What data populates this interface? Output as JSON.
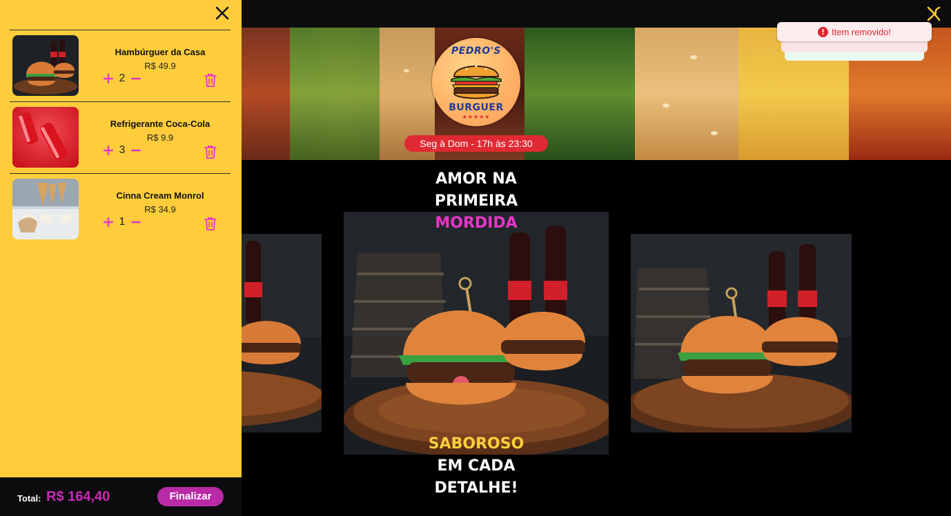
{
  "header": {
    "menu_icon": "utensils-icon"
  },
  "banner": {
    "logo": {
      "top_text": "PEDRO'S",
      "bottom_text": "BURGUER",
      "stars": "★★★★★"
    },
    "hours": "Seg à Dom - 17h às 23:30"
  },
  "main": {
    "tagline_top": {
      "line1": "AMOR NA",
      "line2": "PRIMEIRA",
      "line3": "MORDIDA"
    },
    "tagline_bottom": {
      "line1": "SABOROSO",
      "line2": "EM CADA",
      "line3": "DETALHE!"
    }
  },
  "toast": {
    "icon": "alert-icon",
    "icon_glyph": "!",
    "message": "Item removido!"
  },
  "cart": {
    "close_icon": "close-icon",
    "items": [
      {
        "name": "Hambúrguer da Casa",
        "price": "R$ 49.9",
        "qty": "2",
        "thumb": "burger-photo"
      },
      {
        "name": "Refrigerante Coca-Cola",
        "price": "R$ 9.9",
        "qty": "3",
        "thumb": "soda-can-photo"
      },
      {
        "name": "Cinna Cream Monrol",
        "price": "R$ 34.9",
        "qty": "1",
        "thumb": "ice-cream-photo"
      }
    ],
    "total_label": "Total:",
    "total_value": "R$ 164,40",
    "finalize_label": "Finalizar"
  },
  "colors": {
    "drawer_bg": "#ffcd3c",
    "accent_pink": "#e935c8",
    "accent_magenta": "#b82aa6",
    "hours_red": "#e02a33",
    "toast_red": "#e0262f"
  }
}
